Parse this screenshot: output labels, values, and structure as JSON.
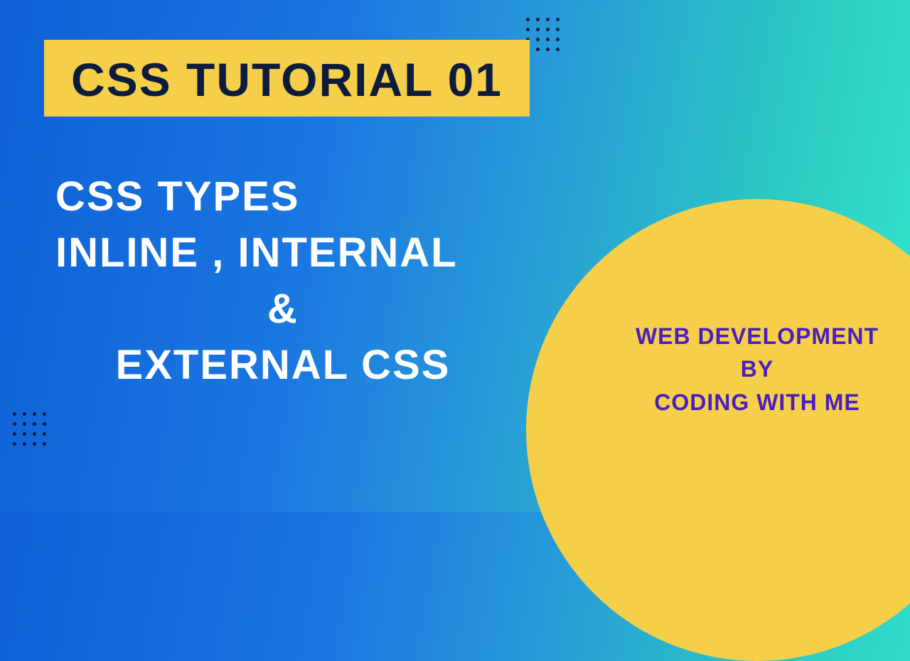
{
  "banner": {
    "title": "CSS TUTORIAL 01"
  },
  "main": {
    "line1": "CSS TYPES",
    "line2": "INLINE , INTERNAL",
    "line3": "&",
    "line4": "EXTERNAL CSS"
  },
  "circle": {
    "line1": "WEB DEVELOPMENT",
    "line2": "BY",
    "line3": "CODING WITH ME"
  }
}
